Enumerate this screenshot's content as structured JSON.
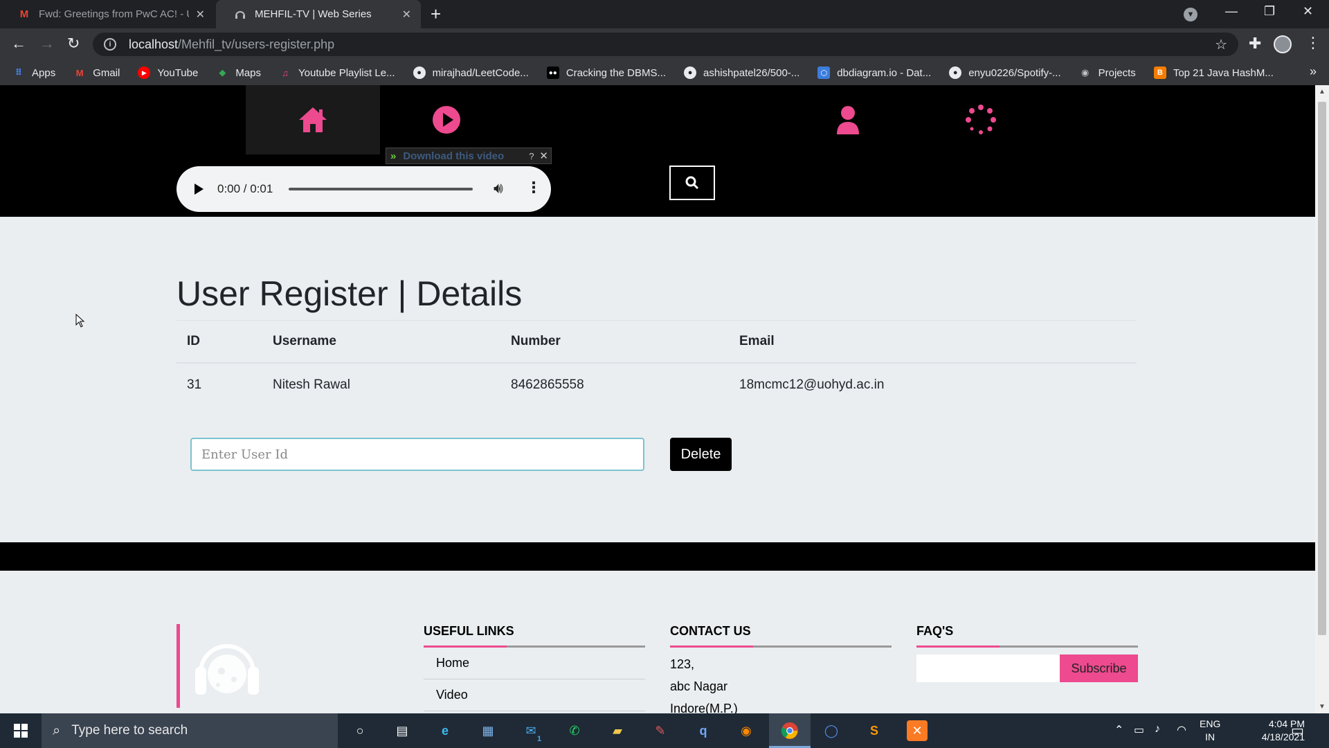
{
  "browser": {
    "tabs": [
      {
        "title": "Fwd: Greetings from PwC AC! - U",
        "active": false
      },
      {
        "title": "MEHFIL-TV | Web Series",
        "active": true
      }
    ],
    "url_host": "localhost",
    "url_path": "/Mehfil_tv/users-register.php",
    "bookmarks": [
      {
        "label": "Apps",
        "icon": "apps-grid-icon"
      },
      {
        "label": "Gmail",
        "icon": "gmail-icon"
      },
      {
        "label": "YouTube",
        "icon": "youtube-icon"
      },
      {
        "label": "Maps",
        "icon": "maps-icon"
      },
      {
        "label": "Youtube Playlist Le...",
        "icon": "music-icon"
      },
      {
        "label": "mirajhad/LeetCode...",
        "icon": "github-icon"
      },
      {
        "label": "Cracking the DBMS...",
        "icon": "medium-icon"
      },
      {
        "label": "ashishpatel26/500-...",
        "icon": "github-icon"
      },
      {
        "label": "dbdiagram.io - Dat...",
        "icon": "dbdiagram-icon"
      },
      {
        "label": "enyu0226/Spotify-...",
        "icon": "github-icon"
      },
      {
        "label": "Projects",
        "icon": "globe-icon"
      },
      {
        "label": "Top 21 Java HashM...",
        "icon": "blogger-icon"
      }
    ]
  },
  "site": {
    "download_bar": {
      "label": "Download this video",
      "help": "?"
    },
    "audio": {
      "time": "0:00 / 0:01",
      "progress": 0
    },
    "title": "User Register | Details",
    "table": {
      "headers": [
        "ID",
        "Username",
        "Number",
        "Email"
      ],
      "rows": [
        [
          "31",
          "Nitesh Rawal",
          "8462865558",
          "18mcmc12@uohyd.ac.in"
        ]
      ]
    },
    "delete_form": {
      "placeholder": "Enter User Id",
      "button": "Delete"
    },
    "footer": {
      "links_heading": "USEFUL LINKS",
      "links": [
        "Home",
        "Video"
      ],
      "contact_heading": "CONTACT US",
      "contact_lines": [
        "123,",
        "abc Nagar",
        "Indore(M.P.)"
      ],
      "faq_heading": "FAQ'S",
      "subscribe_label": "Subscribe"
    },
    "accent_color": "#ed4a8f"
  },
  "taskbar": {
    "search_placeholder": "Type here to search",
    "lang": "ENG",
    "region": "IN",
    "time": "4:04 PM",
    "date": "4/18/2021",
    "mail_badge": "1"
  }
}
